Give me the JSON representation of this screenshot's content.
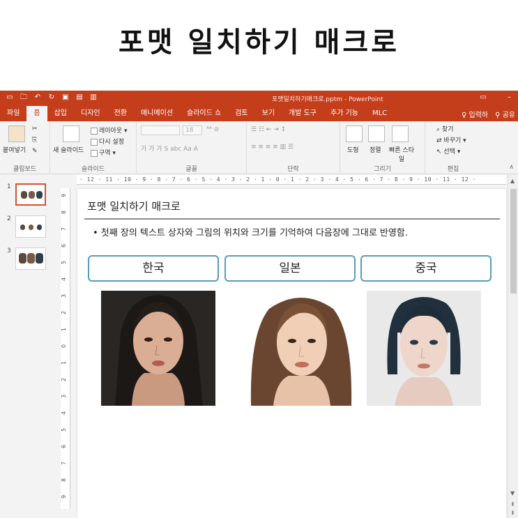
{
  "headline": "포맷 일치하기 매크로",
  "app": {
    "doc_title": "포맷일치하기매크로.pptm - PowerPoint",
    "tabs": [
      "파일",
      "홈",
      "삽입",
      "디자인",
      "전환",
      "애니메이션",
      "슬라이드 쇼",
      "검토",
      "보기",
      "개발 도구",
      "추가 기능",
      "MLC"
    ],
    "tell_me": "입력하",
    "share": "공유"
  },
  "ribbon": {
    "clipboard": {
      "paste": "붙여넣기",
      "label": "클립보드"
    },
    "slides": {
      "new_slide": "새 슬라이드",
      "layout": "레이아웃",
      "reset": "다시 설정",
      "section": "구역",
      "label": "슬라이드"
    },
    "font": {
      "size": "18",
      "label": "글꼴",
      "bold": "가",
      "italic": "가",
      "underline": "가",
      "strike": "S",
      "spacing": "abc",
      "case": "Aa"
    },
    "paragraph": {
      "label": "단락"
    },
    "drawing": {
      "shapes": "도형",
      "arrange": "정렬",
      "quick_styles": "빠른 스타일",
      "label": "그리기"
    },
    "editing": {
      "find": "찾기",
      "replace": "바꾸기",
      "select": "선택",
      "label": "편집"
    }
  },
  "ruler_text": "· 12 · 11 · 10 · 9 · 8 · 7 · 6 · 5 · 4 · 3 · 2 · 1 · 0 · 1 · 2 · 3 · 4 · 5 · 6 · 7 · 8 · 9 · 10 · 11 · 12 ·",
  "vruler": [
    "9",
    "8",
    "7",
    "6",
    "5",
    "4",
    "3",
    "2",
    "1",
    "0",
    "1",
    "2",
    "3",
    "4",
    "5",
    "6",
    "7",
    "8",
    "9"
  ],
  "thumbnails": [
    "1",
    "2",
    "3"
  ],
  "slide": {
    "title": "포맷 일치하기 매크로",
    "bullet": "• 첫째 장의 텍스트 상자와 그림의 위치와 크기를 기억하여 다음장에 그대로 반영함.",
    "labels": [
      "한국",
      "일본",
      "중국"
    ]
  },
  "colors": {
    "accent": "#c43e1c",
    "box_border": "#5b9bb5"
  }
}
